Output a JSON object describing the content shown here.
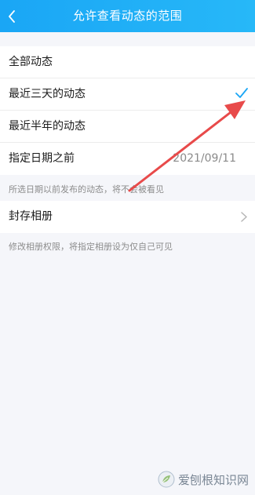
{
  "header": {
    "title": "允许查看动态的范围"
  },
  "options": [
    {
      "label": "全部动态",
      "selected": false
    },
    {
      "label": "最近三天的动态",
      "selected": true
    },
    {
      "label": "最近半年的动态",
      "selected": false
    },
    {
      "label": "指定日期之前",
      "value": "2021/09/11",
      "selected": false
    }
  ],
  "hint_date": "所选日期以前发布的动态，将不会被看见",
  "album": {
    "label": "封存相册",
    "hint": "修改相册权限，将指定相册设为仅自己可见"
  },
  "watermark": {
    "text": "爱刨根知识网"
  },
  "colors": {
    "header_start": "#1aa6f5",
    "header_end": "#27b8f8",
    "check": "#1aa6f5",
    "annotation_arrow": "#e84a4a",
    "page_background": "#f5f6fa"
  }
}
